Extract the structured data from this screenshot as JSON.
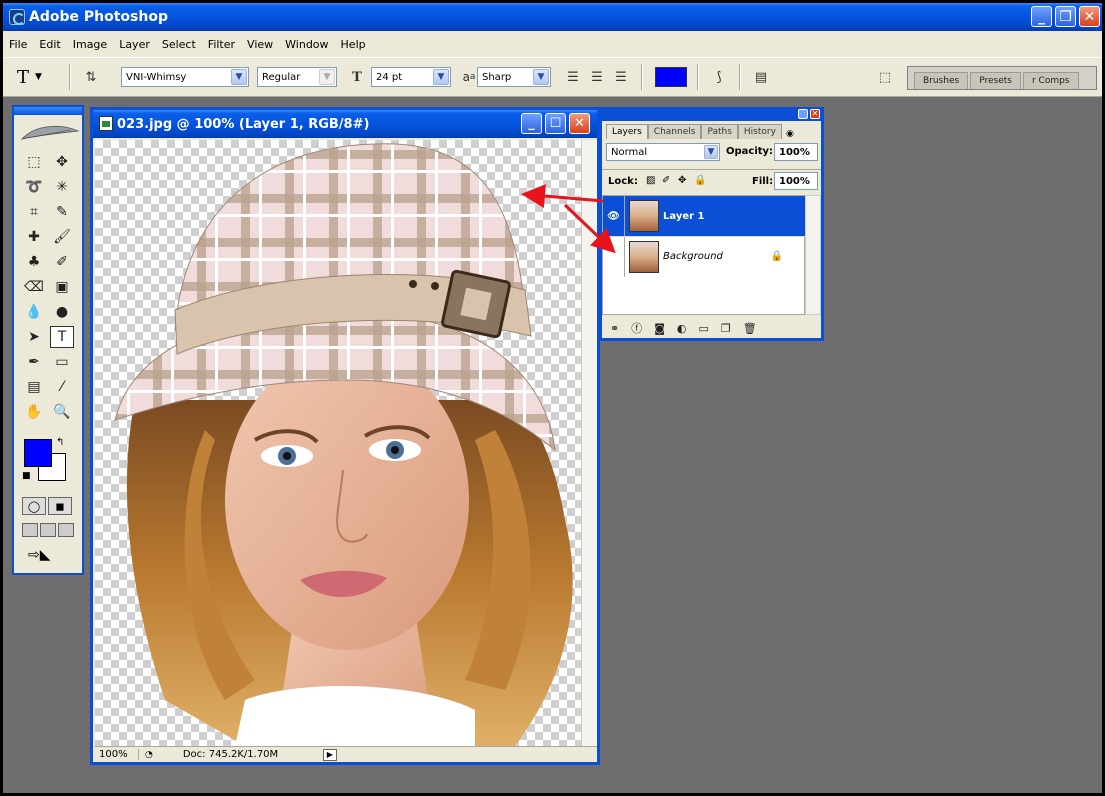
{
  "app": {
    "title": "Adobe Photoshop"
  },
  "menu": [
    "File",
    "Edit",
    "Image",
    "Layer",
    "Select",
    "Filter",
    "View",
    "Window",
    "Help"
  ],
  "options": {
    "tool_icon": "T",
    "font_family": "VNI-Whimsy",
    "font_style": "Regular",
    "font_size": "24 pt",
    "antialias_label": "a",
    "antialias": "Sharp",
    "text_color": "#0000ff"
  },
  "palette_well": {
    "tabs": [
      "Brushes",
      "Presets",
      "r Comps"
    ]
  },
  "document": {
    "title": "023.jpg @ 100% (Layer 1, RGB/8#)",
    "zoom": "100%",
    "doc_info": "Doc: 745.2K/1.70M"
  },
  "layers_palette": {
    "tabs": [
      "Layers",
      "Channels",
      "Paths",
      "History"
    ],
    "blend_mode": "Normal",
    "opacity_label": "Opacity:",
    "opacity": "100%",
    "lock_label": "Lock:",
    "fill_label": "Fill:",
    "fill": "100%",
    "layers": [
      {
        "name": "Layer 1",
        "selected": true,
        "visible": true
      },
      {
        "name": "Background",
        "selected": false,
        "locked": true
      }
    ]
  },
  "colors": {
    "foreground": "#0000ff",
    "background": "#ffffff",
    "accent": "#0a4fd6",
    "annotation_arrow": "#e8141c"
  }
}
